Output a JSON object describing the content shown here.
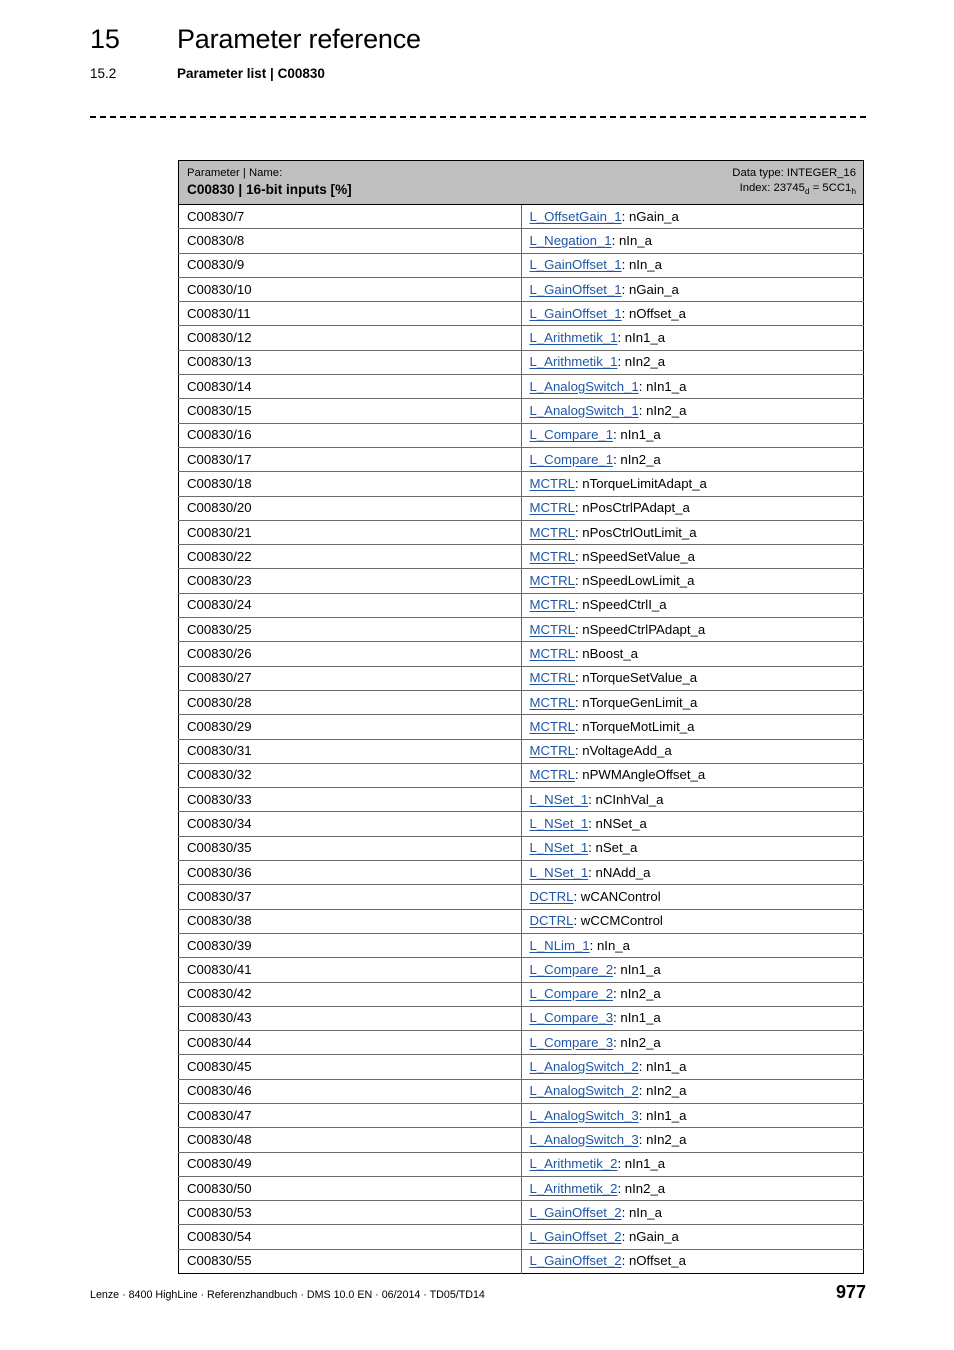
{
  "header": {
    "chapter_number": "15",
    "chapter_title": "Parameter reference",
    "section_number": "15.2",
    "section_title": "Parameter list | C00830"
  },
  "table": {
    "header": {
      "label_small": "Parameter | Name:",
      "label_strong": "C00830 | 16-bit inputs [%]",
      "data_type": "Data type: INTEGER_16",
      "index_prefix": "Index: 23745",
      "index_sub_d": "d",
      "index_mid": " = 5CC1",
      "index_sub_h": "h"
    },
    "rows": [
      {
        "id": "C00830/7",
        "link": "L_OffsetGain_1",
        "signal": ": nGain_a"
      },
      {
        "id": "C00830/8",
        "link": "L_Negation_1",
        "signal": ": nIn_a"
      },
      {
        "id": "C00830/9",
        "link": "L_GainOffset_1",
        "signal": ": nIn_a"
      },
      {
        "id": "C00830/10",
        "link": "L_GainOffset_1",
        "signal": ": nGain_a"
      },
      {
        "id": "C00830/11",
        "link": "L_GainOffset_1",
        "signal": ": nOffset_a"
      },
      {
        "id": "C00830/12",
        "link": "L_Arithmetik_1",
        "signal": ": nIn1_a"
      },
      {
        "id": "C00830/13",
        "link": "L_Arithmetik_1",
        "signal": ": nIn2_a"
      },
      {
        "id": "C00830/14",
        "link": "L_AnalogSwitch_1",
        "signal": ": nIn1_a"
      },
      {
        "id": "C00830/15",
        "link": "L_AnalogSwitch_1",
        "signal": ": nIn2_a"
      },
      {
        "id": "C00830/16",
        "link": "L_Compare_1",
        "signal": ": nIn1_a"
      },
      {
        "id": "C00830/17",
        "link": "L_Compare_1",
        "signal": ": nIn2_a"
      },
      {
        "id": "C00830/18",
        "link": "MCTRL",
        "signal": ": nTorqueLimitAdapt_a"
      },
      {
        "id": "C00830/20",
        "link": "MCTRL",
        "signal": ": nPosCtrlPAdapt_a"
      },
      {
        "id": "C00830/21",
        "link": "MCTRL",
        "signal": ": nPosCtrlOutLimit_a"
      },
      {
        "id": "C00830/22",
        "link": "MCTRL",
        "signal": ": nSpeedSetValue_a"
      },
      {
        "id": "C00830/23",
        "link": "MCTRL",
        "signal": ": nSpeedLowLimit_a"
      },
      {
        "id": "C00830/24",
        "link": "MCTRL",
        "signal": ": nSpeedCtrlI_a"
      },
      {
        "id": "C00830/25",
        "link": "MCTRL",
        "signal": ": nSpeedCtrlPAdapt_a"
      },
      {
        "id": "C00830/26",
        "link": "MCTRL",
        "signal": ": nBoost_a"
      },
      {
        "id": "C00830/27",
        "link": "MCTRL",
        "signal": ": nTorqueSetValue_a"
      },
      {
        "id": "C00830/28",
        "link": "MCTRL",
        "signal": ": nTorqueGenLimit_a"
      },
      {
        "id": "C00830/29",
        "link": "MCTRL",
        "signal": ": nTorqueMotLimit_a"
      },
      {
        "id": "C00830/31",
        "link": "MCTRL",
        "signal": ": nVoltageAdd_a"
      },
      {
        "id": "C00830/32",
        "link": "MCTRL",
        "signal": ": nPWMAngleOffset_a"
      },
      {
        "id": "C00830/33",
        "link": "L_NSet_1",
        "signal": ": nCInhVal_a"
      },
      {
        "id": "C00830/34",
        "link": "L_NSet_1",
        "signal": ": nNSet_a"
      },
      {
        "id": "C00830/35",
        "link": "L_NSet_1",
        "signal": ": nSet_a"
      },
      {
        "id": "C00830/36",
        "link": "L_NSet_1",
        "signal": ": nNAdd_a"
      },
      {
        "id": "C00830/37",
        "link": "DCTRL",
        "signal": ": wCANControl"
      },
      {
        "id": "C00830/38",
        "link": "DCTRL",
        "signal": ": wCCMControl"
      },
      {
        "id": "C00830/39",
        "link": "L_NLim_1",
        "signal": ": nIn_a"
      },
      {
        "id": "C00830/41",
        "link": "L_Compare_2",
        "signal": ": nIn1_a"
      },
      {
        "id": "C00830/42",
        "link": "L_Compare_2",
        "signal": ": nIn2_a"
      },
      {
        "id": "C00830/43",
        "link": "L_Compare_3",
        "signal": ": nIn1_a"
      },
      {
        "id": "C00830/44",
        "link": "L_Compare_3",
        "signal": ": nIn2_a"
      },
      {
        "id": "C00830/45",
        "link": "L_AnalogSwitch_2",
        "signal": ": nIn1_a"
      },
      {
        "id": "C00830/46",
        "link": "L_AnalogSwitch_2",
        "signal": ": nIn2_a"
      },
      {
        "id": "C00830/47",
        "link": "L_AnalogSwitch_3",
        "signal": ": nIn1_a"
      },
      {
        "id": "C00830/48",
        "link": "L_AnalogSwitch_3",
        "signal": ": nIn2_a"
      },
      {
        "id": "C00830/49",
        "link": "L_Arithmetik_2",
        "signal": ": nIn1_a"
      },
      {
        "id": "C00830/50",
        "link": "L_Arithmetik_2",
        "signal": ": nIn2_a"
      },
      {
        "id": "C00830/53",
        "link": "L_GainOffset_2",
        "signal": ": nIn_a"
      },
      {
        "id": "C00830/54",
        "link": "L_GainOffset_2",
        "signal": ": nGain_a"
      },
      {
        "id": "C00830/55",
        "link": "L_GainOffset_2",
        "signal": ": nOffset_a"
      }
    ]
  },
  "footer": {
    "text": "Lenze · 8400 HighLine · Referenzhandbuch · DMS 10.0 EN · 06/2014 · TD05/TD14",
    "page_number": "977"
  },
  "colors": {
    "link": "#1f56a8",
    "header_bg": "#bfbfbf",
    "rule": "#6b6b6b"
  }
}
